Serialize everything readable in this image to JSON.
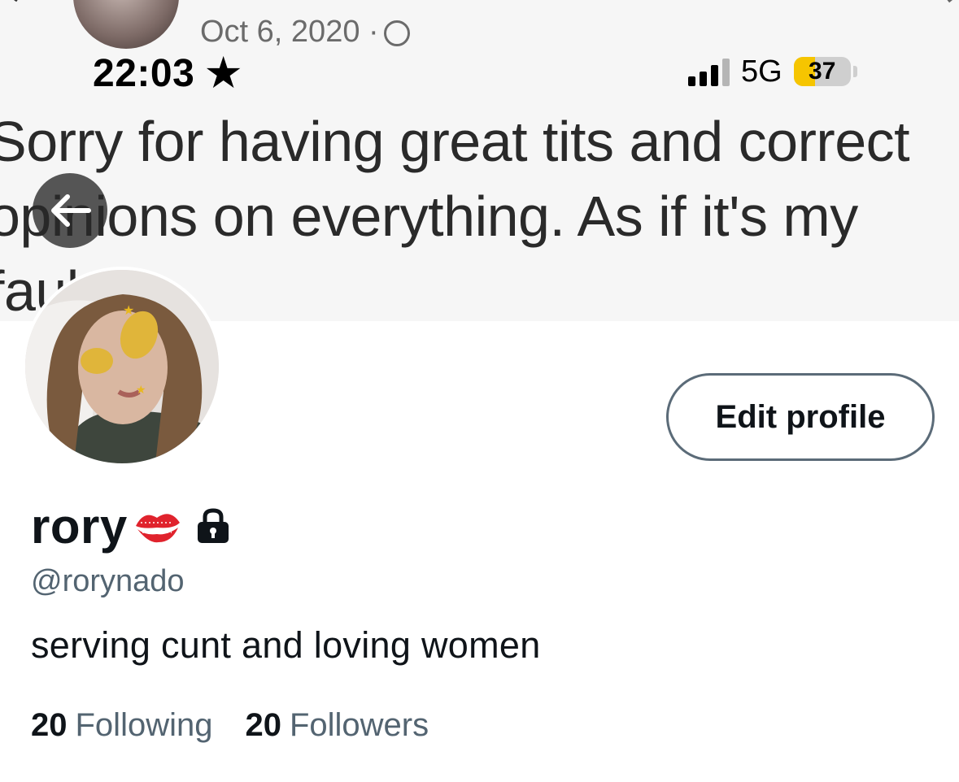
{
  "banner": {
    "date": "Oct 6, 2020 ·",
    "text_line1": "Sorry for having great tits and correct",
    "text_line2": "opinions on everything. As if it's my",
    "text_line3": "fault."
  },
  "status_bar": {
    "time": "22:03",
    "network": "5G",
    "battery": "37",
    "battery_level": 0.37
  },
  "profile": {
    "edit_label": "Edit profile",
    "display_name": "rory",
    "handle": "@rorynado",
    "bio": "serving cunt and loving women",
    "following_count": "20",
    "following_label": "Following",
    "followers_count": "20",
    "followers_label": "Followers"
  },
  "colors": {
    "secondary_text": "#536471",
    "battery_yellow": "#f6c500",
    "button_border": "#5b6b78"
  }
}
